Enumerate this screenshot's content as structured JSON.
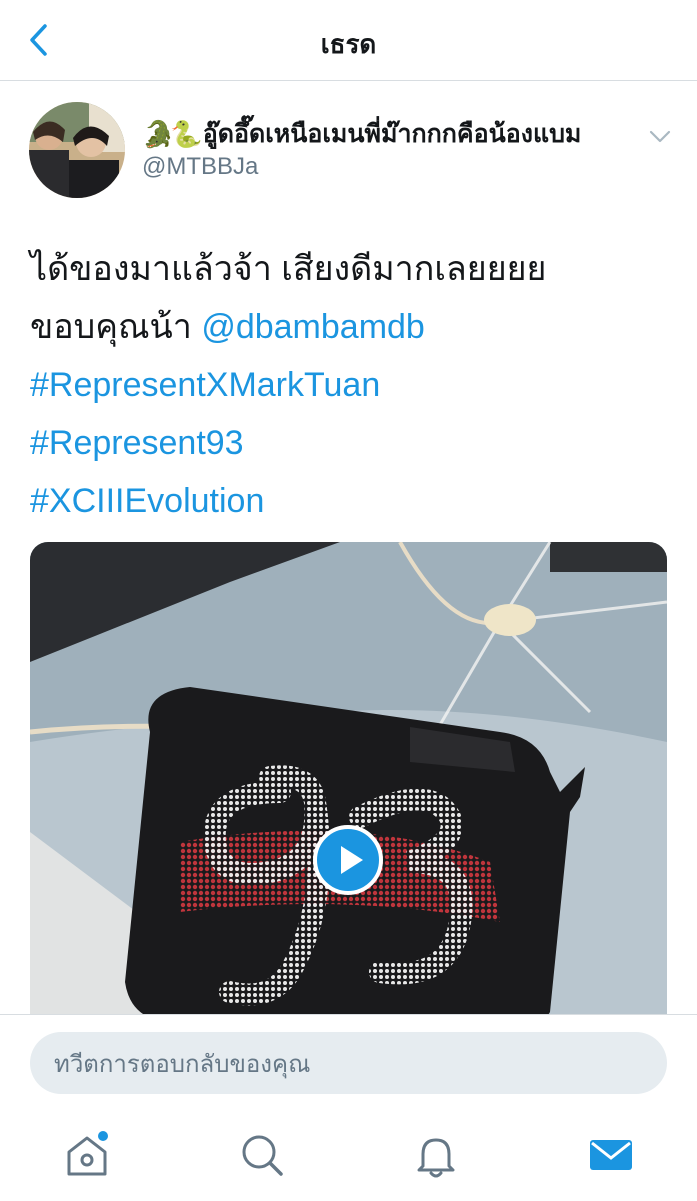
{
  "header": {
    "title": "เธรด"
  },
  "tweet": {
    "author_emoji": "🐊🐍",
    "author_name": "อู๊ดอึ๊ดเหนือเมนพี่ม๊ากกกคือน้องแบม",
    "handle": "@MTBBJa",
    "text_line1": "ได้ของมาแล้วจ้า เสียงดีมากเลยยยย",
    "text_line2_prefix": "ขอบคุณน้า ",
    "mention": "@dbambamdb",
    "hashtags": [
      "#RepresentXMarkTuan",
      "#Represent93",
      "#XCIIIEvolution"
    ]
  },
  "reply": {
    "placeholder": "ทวีตการตอบกลับของคุณ"
  },
  "colors": {
    "accent": "#1b95e0",
    "text": "#14171a",
    "muted": "#657786",
    "input_bg": "#e6ecf0"
  },
  "icons": [
    "chevron-left-icon",
    "chevron-down-icon",
    "play-icon",
    "home-icon",
    "search-icon",
    "bell-icon",
    "mail-icon"
  ]
}
